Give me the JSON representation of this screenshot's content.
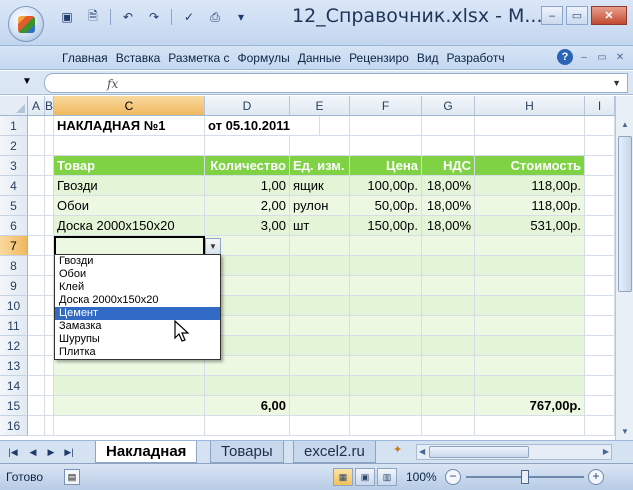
{
  "window": {
    "title": "12_Справочник.xlsx - M...",
    "controls": [
      "minimize",
      "maximize",
      "close"
    ]
  },
  "quick_access": [
    "save-icon",
    "print-preview-icon",
    "undo-icon",
    "redo-icon",
    "spellcheck-icon",
    "print-icon",
    "customize-icon"
  ],
  "ribbon": {
    "tabs": [
      "Главная",
      "Вставка",
      "Разметка с",
      "Формулы",
      "Данные",
      "Рецензиро",
      "Вид",
      "Разработч"
    ],
    "help": "?"
  },
  "formula_bar": {
    "fx": "fx",
    "value": ""
  },
  "columns": [
    "A",
    "B",
    "C",
    "D",
    "E",
    "F",
    "G",
    "H",
    "I"
  ],
  "rows": [
    "1",
    "2",
    "3",
    "4",
    "5",
    "6",
    "7",
    "8",
    "9",
    "10",
    "11",
    "12",
    "13",
    "14",
    "15",
    "16"
  ],
  "sheet": {
    "title": "НАКЛАДНАЯ №1",
    "date": "от 05.10.2011",
    "headers": [
      "Товар",
      "Количество",
      "Ед. изм.",
      "Цена",
      "НДС",
      "Стоимость"
    ],
    "items": [
      [
        "Гвозди",
        "1,00",
        "ящик",
        "100,00р.",
        "18,00%",
        "118,00р."
      ],
      [
        "Обои",
        "2,00",
        "рулон",
        "50,00р.",
        "18,00%",
        "118,00р."
      ],
      [
        "Доска 2000х150х20",
        "3,00",
        "шт",
        "150,00р.",
        "18,00%",
        "531,00р."
      ]
    ],
    "totals": {
      "quantity": "6,00",
      "cost": "767,00р."
    }
  },
  "dropdown": {
    "items": [
      "Гвозди",
      "Обои",
      "Клей",
      "Доска 2000х150х20",
      "Цемент",
      "Замазка",
      "Шурупы",
      "Плитка"
    ],
    "selected": "Цемент"
  },
  "sheet_tabs": [
    "Накладная",
    "Товары",
    "excel2.ru"
  ],
  "active_sheet": "Накладная",
  "status": {
    "text": "Готово",
    "zoom": "100%",
    "zoom_level": 1.0
  }
}
